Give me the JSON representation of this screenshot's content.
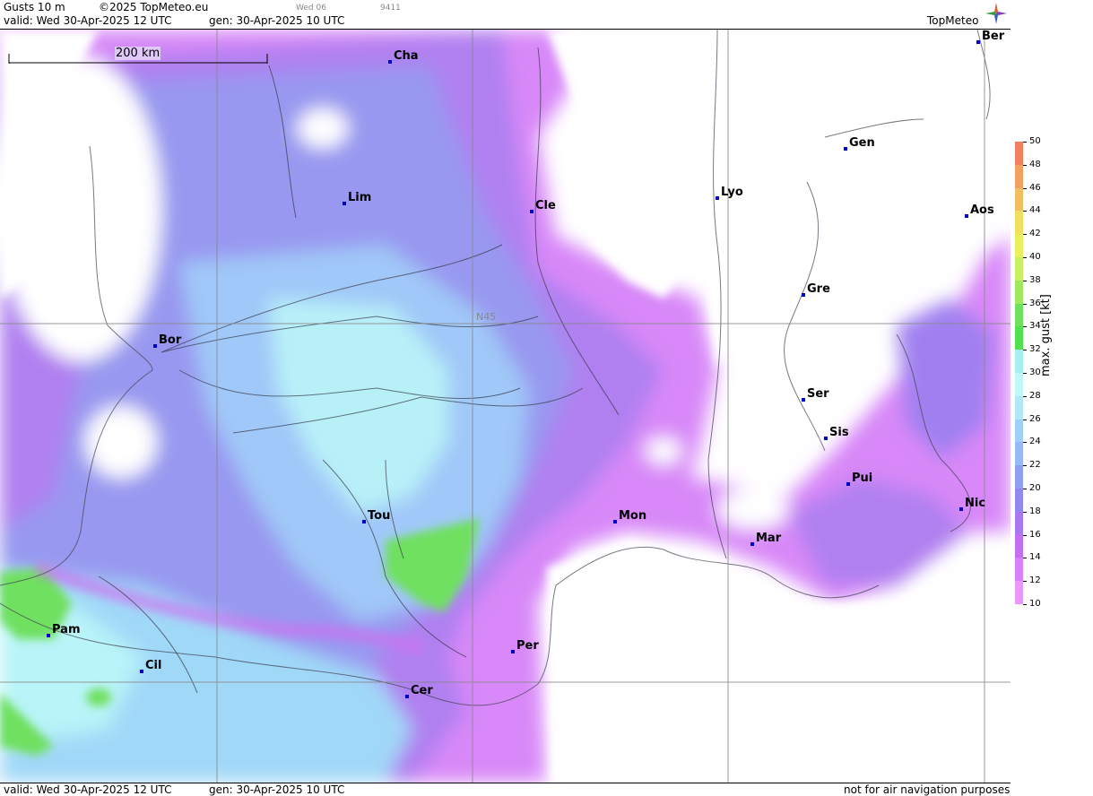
{
  "header": {
    "param": "Gusts 10 m",
    "copyright": "©2025 TopMeteo.eu",
    "day_code": "Wed 06",
    "code": "9411",
    "valid": "valid:  Wed  30-Apr-2025  12 UTC",
    "gen": "gen: 30-Apr-2025 10 UTC",
    "logo": "TopMeteo"
  },
  "map": {
    "scale_label": "200 km",
    "lat_label": "N45",
    "cities": [
      {
        "name": "Cha"
      },
      {
        "name": "Ber"
      },
      {
        "name": "Gen"
      },
      {
        "name": "Lim"
      },
      {
        "name": "Cle"
      },
      {
        "name": "Lyo"
      },
      {
        "name": "Aos"
      },
      {
        "name": "Gre"
      },
      {
        "name": "Bor"
      },
      {
        "name": "Ser"
      },
      {
        "name": "Sis"
      },
      {
        "name": "Pui"
      },
      {
        "name": "Tou"
      },
      {
        "name": "Mon"
      },
      {
        "name": "Nic"
      },
      {
        "name": "Mar"
      },
      {
        "name": "Pam"
      },
      {
        "name": "Per"
      },
      {
        "name": "Cil"
      },
      {
        "name": "Cer"
      }
    ]
  },
  "legend": {
    "unit": "max. gust [kt]",
    "ticks": [
      "50",
      "48",
      "46",
      "44",
      "42",
      "40",
      "38",
      "36",
      "34",
      "32",
      "30",
      "28",
      "26",
      "24",
      "22",
      "20",
      "18",
      "16",
      "14",
      "12",
      "10"
    ],
    "colors": [
      "#f08060",
      "#f0a060",
      "#f0c060",
      "#f0e060",
      "#e8f060",
      "#c8f060",
      "#a0e860",
      "#70e060",
      "#50e050",
      "#a8f0f0",
      "#c0f8f8",
      "#b0e8f8",
      "#a0d0f8",
      "#98b8f8",
      "#90a0f0",
      "#9088f0",
      "#a878f0",
      "#c070f0",
      "#d880f8",
      "#e898f8"
    ]
  },
  "footer": {
    "valid": "valid:  Wed  30-Apr-2025  12 UTC",
    "gen": "gen: 30-Apr-2025 10 UTC",
    "note": "not for air navigation purposes"
  }
}
